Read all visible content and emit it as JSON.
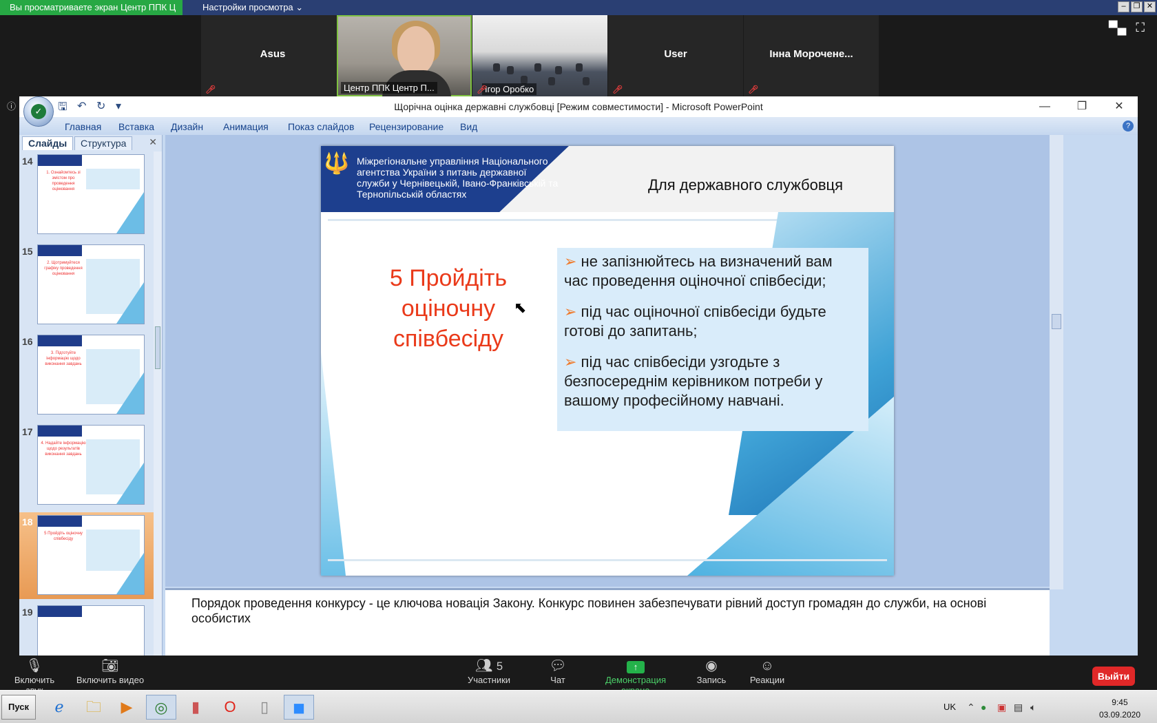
{
  "zoom": {
    "share_badge": "Вы просматриваете экран Центр ППК Ц",
    "view_options": "Настройки просмотра ⌄",
    "participants": [
      {
        "name": "Asus"
      },
      {
        "name": "Центр ППК Центр П..."
      },
      {
        "name": "Ігор Оробко"
      },
      {
        "name": "User"
      },
      {
        "name": "Інна  Мороченe..."
      }
    ],
    "controls": {
      "audio": "Включить звук",
      "video": "Включить видео",
      "participants": "Участники",
      "participants_count": "5",
      "chat": "Чат",
      "share": "Демонстрация экрана",
      "record": "Запись",
      "reactions": "Реакции",
      "leave": "Выйти"
    }
  },
  "powerpoint": {
    "title": "Щорічна оцінка державні службовці [Режим совместимости] - Microsoft PowerPoint",
    "ribbon_tabs": [
      "Главная",
      "Вставка",
      "Дизайн",
      "Анимация",
      "Показ слайдов",
      "Рецензирование",
      "Вид"
    ],
    "pane_tabs": {
      "slides": "Слайды",
      "outline": "Структура"
    },
    "thumbnails": [
      {
        "num": "14",
        "title": "1. Ознайомтесь зі змістом про проведення оцінювання"
      },
      {
        "num": "15",
        "title": "2. Щотримуйтеся графіку проведення оцінювання"
      },
      {
        "num": "16",
        "title": "3. Підготуйте інформацію щодо виконання завдань"
      },
      {
        "num": "17",
        "title": "4. Надайте інформацію щодо результатів виконання завдань"
      },
      {
        "num": "18",
        "title": "5 Пройдіть оціночну співбесіду"
      },
      {
        "num": "19",
        "title": ""
      }
    ],
    "slide": {
      "org": "Міжрегіональне управління Національного агентства України з питань державної служби  у Чернівецькій, Івано-Франківській та Тернопільській областях",
      "subtitle": "Для державного службовця",
      "title_line1": "5 Пройдіть",
      "title_line2": "оціночну",
      "title_line3": "співбесіду",
      "bullets": [
        "не запізнюйтесь на визначений вам час проведення оціночної співбесіди;",
        "під час оціночної співбесіди будьте готові до запитань;",
        "під час співбесіди узгодьте з безпосереднім керівником потреби у вашому професійному навчані."
      ]
    },
    "notes": "Порядок проведення  конкурсу - це ключова новація Закону. Конкурс повинен забезпечувати  рівний доступ громадян до служби, на основі особистих"
  },
  "taskbar": {
    "start": "Пуск",
    "lang": "UK",
    "time": "9:45",
    "date": "03.09.2020"
  }
}
